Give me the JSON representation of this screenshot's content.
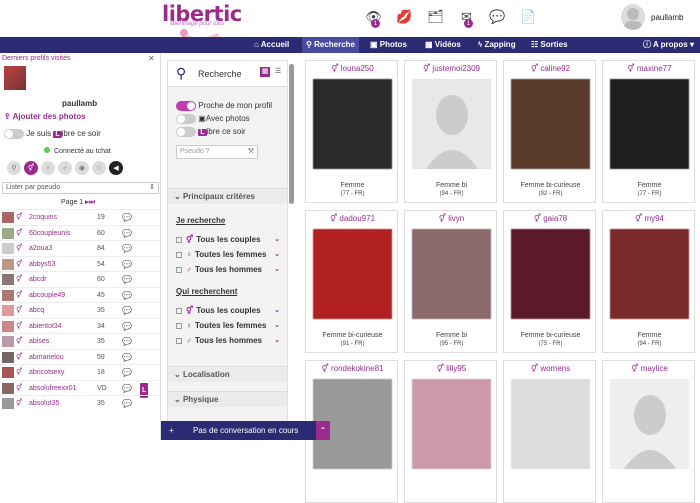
{
  "logo": {
    "text": "libertic",
    "tagline": "libertinage pour tous"
  },
  "header": {
    "icons": [
      {
        "name": "eye-icon",
        "glyph": "👁",
        "badge": "1"
      },
      {
        "name": "lips-icon",
        "glyph": "💋",
        "badge": ""
      },
      {
        "name": "album-icon",
        "glyph": "🗂",
        "badge": ""
      },
      {
        "name": "mail-icon",
        "glyph": "✉",
        "badge": "1"
      },
      {
        "name": "chat-icon",
        "glyph": "💬",
        "badge": ""
      },
      {
        "name": "doc-icon",
        "glyph": "📄",
        "badge": ""
      }
    ],
    "username": "paullamb"
  },
  "nav": {
    "accueil": "Accueil",
    "recherche": "Recherche",
    "photos": "Photos",
    "videos": "Vidéos",
    "zapping": "Zapping",
    "sorties": "Sorties",
    "apropos": "A propos"
  },
  "left": {
    "title": "Derniers profils visités",
    "username": "paullamb",
    "add_photos": "Ajouter des photos",
    "libre_pre": "Je suis",
    "libre_post": "ibre ce soir",
    "libre_l": "L",
    "tchat": "Connecté au tchat",
    "sort": "Lister par pseudo",
    "page": "Page 1",
    "users": [
      {
        "name": "2coquins",
        "age": "19",
        "sx": "⚥",
        "l": ""
      },
      {
        "name": "60coupleunis",
        "age": "60",
        "sx": "⚥",
        "l": ""
      },
      {
        "name": "a2oua3",
        "age": "84",
        "sx": "⚥",
        "l": ""
      },
      {
        "name": "abbys53",
        "age": "54",
        "sx": "⚥",
        "l": ""
      },
      {
        "name": "abcdr",
        "age": "60",
        "sx": "⚥",
        "l": ""
      },
      {
        "name": "abcouple49",
        "age": "45",
        "sx": "⚥",
        "l": ""
      },
      {
        "name": "abcq",
        "age": "35",
        "sx": "⚥",
        "l": ""
      },
      {
        "name": "abientot34",
        "age": "34",
        "sx": "⚥",
        "l": ""
      },
      {
        "name": "abises",
        "age": "35",
        "sx": "⚥",
        "l": ""
      },
      {
        "name": "abmarielou",
        "age": "59",
        "sx": "⚥",
        "l": ""
      },
      {
        "name": "abricotsexy",
        "age": "18",
        "sx": "⚥",
        "l": ""
      },
      {
        "name": "absolufreexx01",
        "age": "VD",
        "sx": "⚥",
        "l": "L"
      },
      {
        "name": "absolut35",
        "age": "35",
        "sx": "⚥",
        "l": ""
      }
    ]
  },
  "filter": {
    "title": "Recherche",
    "proche": "Proche de mon profil",
    "photos": "Avec photos",
    "libre_l": "L",
    "libre": "ibre ce soir",
    "pseudo_placeholder": "Pseudo ?",
    "principaux": "Principaux critères",
    "je_recherche": "Je recherche",
    "qui_recherchent": "Qui recherchent",
    "opts1": [
      "Tous les couples",
      "Toutes les femmes",
      "Tous les hommes"
    ],
    "opts2": [
      "Tous les couples",
      "Toutes les femmes",
      "Tous les hommes"
    ],
    "localisation": "Localisation",
    "physique": "Physique"
  },
  "cards": [
    {
      "name": "louna250",
      "gender": "Femme",
      "loc": "(77 - FR)",
      "color": "#2a2a2a"
    },
    {
      "name": "justemoi2309",
      "gender": "Femme bi",
      "loc": "(94 - FR)",
      "color": "#e8e8e8"
    },
    {
      "name": "caline92",
      "gender": "Femme bi-curieuse",
      "loc": "(92 - FR)",
      "color": "#5a3a2a"
    },
    {
      "name": "maxine77",
      "gender": "Femme",
      "loc": "(77 - FR)",
      "color": "#1e1e1e"
    },
    {
      "name": "dadou971",
      "gender": "Femme bi-curieuse",
      "loc": "(91 - FR)",
      "color": "#b02020"
    },
    {
      "name": "livyn",
      "gender": "Femme bi",
      "loc": "(95 - FR)",
      "color": "#8a6a6a"
    },
    {
      "name": "gaia78",
      "gender": "Femme bi-curieuse",
      "loc": "(75 - FR)",
      "color": "#5a1a2a"
    },
    {
      "name": "my94",
      "gender": "Femme",
      "loc": "(94 - FR)",
      "color": "#7a2a2a"
    },
    {
      "name": "rondekokine81",
      "gender": "",
      "loc": "",
      "color": "#999"
    },
    {
      "name": "lilly95",
      "gender": "",
      "loc": "",
      "color": "#c9a"
    },
    {
      "name": "womens",
      "gender": "",
      "loc": "",
      "color": "#ddd"
    },
    {
      "name": "maylice",
      "gender": "",
      "loc": "",
      "color": "#eee"
    }
  ],
  "chat": {
    "text": "Pas de conversation en cours",
    "plus": "+",
    "up": "⌃"
  }
}
